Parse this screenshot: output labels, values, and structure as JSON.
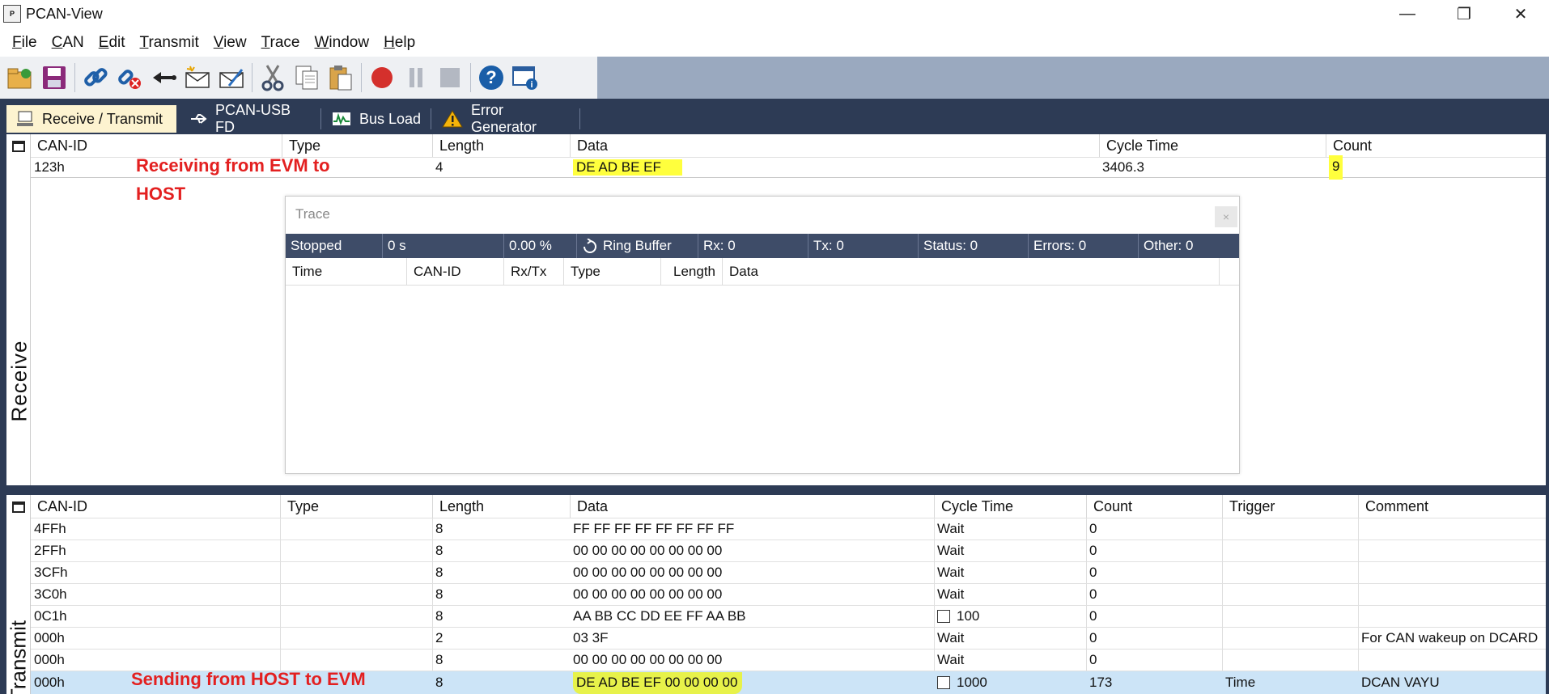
{
  "window": {
    "title": "PCAN-View",
    "minimize": "—",
    "restore": "❐",
    "close": "✕"
  },
  "menu": [
    {
      "label": "File",
      "key": "F",
      "rest": "ile"
    },
    {
      "label": "CAN",
      "key": "C",
      "rest": "AN"
    },
    {
      "label": "Edit",
      "key": "E",
      "rest": "dit"
    },
    {
      "label": "Transmit",
      "key": "T",
      "rest": "ransmit"
    },
    {
      "label": "View",
      "key": "V",
      "rest": "iew"
    },
    {
      "label": "Trace",
      "key": "T",
      "rest": "race"
    },
    {
      "label": "Window",
      "key": "W",
      "rest": "indow"
    },
    {
      "label": "Help",
      "key": "H",
      "rest": "elp"
    }
  ],
  "toolbar": [
    "connect-folder-icon",
    "save-icon",
    "link-icon",
    "disconnect-icon",
    "arrow-back-icon",
    "new-message-icon",
    "edit-message-icon",
    "cut-icon",
    "copy-icon",
    "paste-icon",
    "record-icon",
    "pause-icon",
    "stop-icon",
    "help-icon",
    "window-info-icon"
  ],
  "tabs": [
    {
      "label": "Receive / Transmit",
      "active": true
    },
    {
      "label": "PCAN-USB FD"
    },
    {
      "label": "Bus Load"
    },
    {
      "label": "Error Generator"
    }
  ],
  "receive": {
    "side_label": "Receive",
    "columns": [
      "CAN-ID",
      "Type",
      "Length",
      "Data",
      "Cycle Time",
      "Count"
    ],
    "rows": [
      {
        "can_id": "123h",
        "type": "",
        "length": "4",
        "data": "DE AD BE EF",
        "cycle_time": "3406.3",
        "count": "9"
      }
    ],
    "annotation": [
      "Receiving from EVM to",
      "HOST"
    ]
  },
  "trace": {
    "title": "Trace",
    "close": "×",
    "status": {
      "state": "Stopped",
      "time": "0 s",
      "percent": "0.00 %",
      "buffer": "Ring Buffer",
      "rx": "Rx: 0",
      "tx": "Tx: 0",
      "status": "Status: 0",
      "errors": "Errors: 0",
      "other": "Other: 0"
    },
    "columns": [
      "Time",
      "CAN-ID",
      "Rx/Tx",
      "Type",
      "Length",
      "Data"
    ]
  },
  "transmit": {
    "side_label": "Transmit",
    "columns": [
      "CAN-ID",
      "Type",
      "Length",
      "Data",
      "Cycle Time",
      "Count",
      "Trigger",
      "Comment"
    ],
    "rows": [
      {
        "can_id": "4FFh",
        "type": "",
        "length": "8",
        "data": "FF FF FF FF FF FF FF FF",
        "cycle_time": "Wait",
        "checkbox": false,
        "count": "0",
        "trigger": "",
        "comment": ""
      },
      {
        "can_id": "2FFh",
        "type": "",
        "length": "8",
        "data": "00 00 00 00 00 00 00 00",
        "cycle_time": "Wait",
        "checkbox": false,
        "count": "0",
        "trigger": "",
        "comment": ""
      },
      {
        "can_id": "3CFh",
        "type": "",
        "length": "8",
        "data": "00 00 00 00 00 00 00 00",
        "cycle_time": "Wait",
        "checkbox": false,
        "count": "0",
        "trigger": "",
        "comment": ""
      },
      {
        "can_id": "3C0h",
        "type": "",
        "length": "8",
        "data": "00 00 00 00 00 00 00 00",
        "cycle_time": "Wait",
        "checkbox": false,
        "count": "0",
        "trigger": "",
        "comment": ""
      },
      {
        "can_id": "0C1h",
        "type": "",
        "length": "8",
        "data": "AA BB CC DD EE FF AA BB",
        "cycle_time": "100",
        "checkbox": true,
        "count": "0",
        "trigger": "",
        "comment": ""
      },
      {
        "can_id": "000h",
        "type": "",
        "length": "2",
        "data": "03 3F",
        "cycle_time": "Wait",
        "checkbox": false,
        "count": "0",
        "trigger": "",
        "comment": "For CAN wakeup on DCARD"
      },
      {
        "can_id": "000h",
        "type": "",
        "length": "8",
        "data": "00 00 00 00 00 00 00 00",
        "cycle_time": "Wait",
        "checkbox": false,
        "count": "0",
        "trigger": "",
        "comment": ""
      },
      {
        "can_id": "000h",
        "type": "",
        "length": "8",
        "data": "DE AD BE EF 00 00 00 00",
        "cycle_time": "1000",
        "checkbox": true,
        "count": "173",
        "trigger": "Time",
        "comment": "DCAN VAYU",
        "selected": true
      }
    ],
    "annotation": "Sending from HOST to EVM"
  },
  "colors": {
    "frame": "#2d3b55",
    "highlight": "#ffff3d",
    "annotation": "#e32020",
    "selected_row": "#cce4f7"
  }
}
